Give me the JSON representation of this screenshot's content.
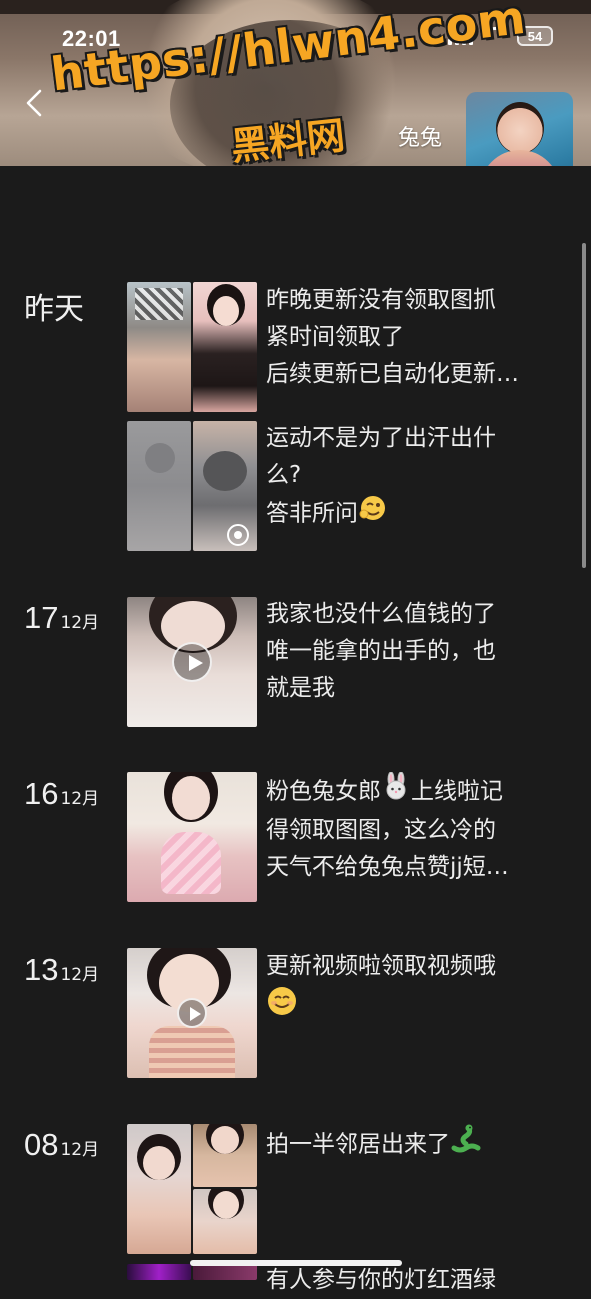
{
  "status_bar": {
    "time": "22:01",
    "battery": "54"
  },
  "header": {
    "username": "兔兔",
    "watermark_url": "https://hlwn4.com",
    "watermark_site": "黑料网"
  },
  "posts": [
    {
      "date": "昨天",
      "lines": [
        "昨晚更新没有领取图抓",
        "紧时间领取了",
        "后续更新已自动化更新…"
      ]
    },
    {
      "date": "",
      "lines": [
        "运动不是为了出汗出什",
        "么?",
        "答非所问"
      ]
    },
    {
      "day": "17",
      "month": "12月",
      "lines": [
        "我家也没什么值钱的了",
        "唯一能拿的出手的，也",
        "就是我"
      ]
    },
    {
      "day": "16",
      "month": "12月",
      "lines": [
        "粉色兔女郎",
        "得领取图图，这么冷的",
        "天气不给兔兔点赞jj短…"
      ],
      "line1_suffix": "上线啦记"
    },
    {
      "day": "13",
      "month": "12月",
      "lines": [
        "更新视频啦领取视频哦"
      ]
    },
    {
      "day": "08",
      "month": "12月",
      "lines": [
        "拍一半邻居出来了"
      ]
    },
    {
      "lines": [
        "有人参与你的灯红酒绿"
      ]
    }
  ],
  "icons": {
    "back": "chevron-left-icon",
    "play": "play-icon",
    "live_photo": "live-photo-icon"
  }
}
